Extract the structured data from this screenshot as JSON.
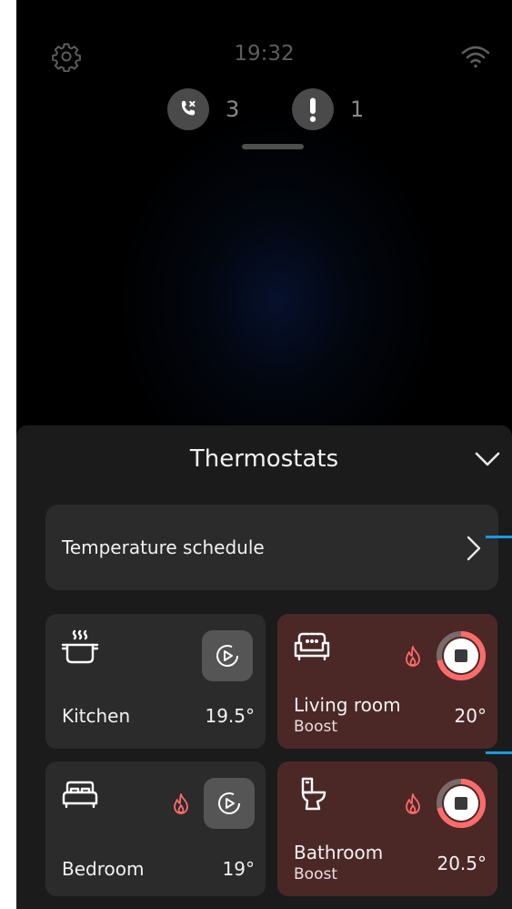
{
  "status_bar": {
    "time": "19:32"
  },
  "notifications": {
    "missed_calls": "3",
    "alerts": "1"
  },
  "sheet": {
    "title": "Thermostats",
    "schedule_label": "Temperature schedule"
  },
  "rooms": [
    {
      "name": "Kitchen",
      "temp": "19.5°",
      "mode": "",
      "icon": "cooking-pot-icon",
      "heating": false,
      "control": "play"
    },
    {
      "name": "Living room",
      "temp": "20°",
      "mode": "Boost",
      "icon": "sofa-icon",
      "heating": true,
      "control": "stop"
    },
    {
      "name": "Bedroom",
      "temp": "19°",
      "mode": "",
      "icon": "bed-icon",
      "heating": true,
      "control": "play"
    },
    {
      "name": "Bathroom",
      "temp": "20.5°",
      "mode": "Boost",
      "icon": "toilet-icon",
      "heating": true,
      "control": "stop"
    }
  ],
  "colors": {
    "boost_card": "#4b2826",
    "flame": "#ff6b6b",
    "accent_edge": "#1a9be0"
  }
}
